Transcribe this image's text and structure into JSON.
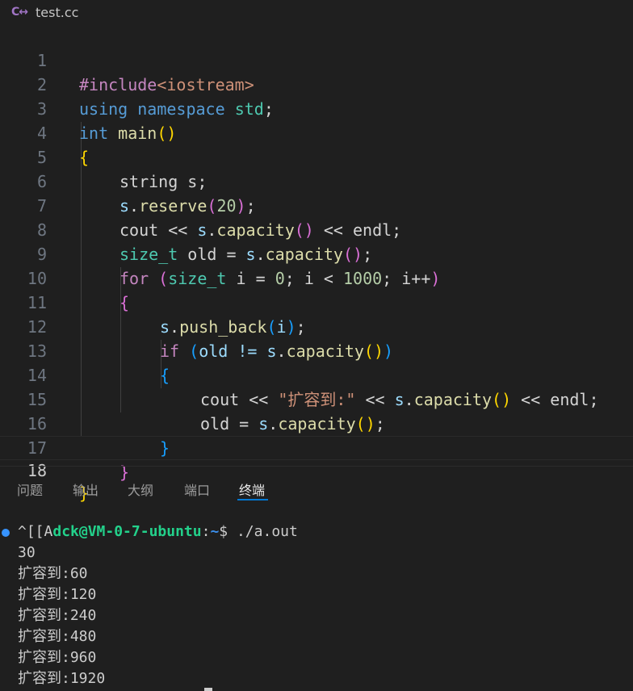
{
  "tab": {
    "icon": "cpp-icon",
    "filename": "test.cc"
  },
  "code_lines": [
    {
      "n": "1"
    },
    {
      "n": "2"
    },
    {
      "n": "3"
    },
    {
      "n": "4"
    },
    {
      "n": "5"
    },
    {
      "n": "6"
    },
    {
      "n": "7"
    },
    {
      "n": "8"
    },
    {
      "n": "9"
    },
    {
      "n": "10"
    },
    {
      "n": "11"
    },
    {
      "n": "12"
    },
    {
      "n": "13"
    },
    {
      "n": "14"
    },
    {
      "n": "15"
    },
    {
      "n": "16"
    },
    {
      "n": "17"
    },
    {
      "n": "18"
    }
  ],
  "code": {
    "l1": {
      "a": "#include",
      "b": "<iostream>"
    },
    "l2": {
      "a": "using",
      "b": "namespace",
      "c": "std",
      "d": ";"
    },
    "l3": {
      "a": "int",
      "b": "main",
      "c": "(",
      "d": ")"
    },
    "l4": {
      "a": "{"
    },
    "l5": {
      "a": "string s;"
    },
    "l6": {
      "a": "s",
      "b": ".",
      "c": "reserve",
      "d": "(",
      "e": "20",
      "f": ");"
    },
    "l7": {
      "a": "cout << ",
      "b": "s",
      "c": ".",
      "d": "capacity",
      "e": "()",
      "f": " << endl;"
    },
    "l8": {
      "a": "size_t",
      "b": " old = ",
      "c": "s",
      "d": ".",
      "e": "capacity",
      "f": "()",
      "g": ";"
    },
    "l9": {
      "a": "for",
      "b": " (",
      "c": "size_t",
      "d": " i = ",
      "e": "0",
      "f": "; i < ",
      "g": "1000",
      "h": "; i++",
      "i": ")"
    },
    "l10": {
      "a": "{"
    },
    "l11": {
      "a": "s",
      "b": ".",
      "c": "push_back",
      "d": "(",
      "e": "i",
      "f": ");"
    },
    "l12": {
      "a": "if",
      "b": " (",
      "c": "old != ",
      "d": "s",
      "e": ".",
      "f": "capacity",
      "g": "()",
      "h": ")"
    },
    "l13": {
      "a": "{"
    },
    "l14": {
      "a": "cout << ",
      "b": "\"扩容到:\"",
      "c": " << ",
      "d": "s",
      "e": ".",
      "f": "capacity",
      "g": "()",
      "h": " << endl;"
    },
    "l15": {
      "a": "old = ",
      "b": "s",
      "c": ".",
      "d": "capacity",
      "e": "()",
      "f": ";"
    },
    "l16": {
      "a": "}"
    },
    "l17": {
      "a": "}"
    },
    "l18": {
      "a": "}"
    }
  },
  "panel": {
    "tabs": [
      "问题",
      "输出",
      "大纲",
      "端口",
      "终端"
    ],
    "active_tab": "终端"
  },
  "terminal": {
    "prompt_prefix": "^[[A",
    "user_host": "dck@VM-0-7-ubuntu",
    "colon": ":",
    "path": "~",
    "dollar": "$ ",
    "command": "./a.out",
    "output": [
      "30",
      "扩容到:60",
      "扩容到:120",
      "扩容到:240",
      "扩容到:480",
      "扩容到:960",
      "扩容到:1920"
    ]
  },
  "colors": {
    "accent": "#0078d4",
    "keyword": "#569cd6",
    "control": "#c586c0",
    "function": "#dcdcaa",
    "type": "#4ec9b0",
    "string": "#ce9178",
    "number": "#b5cea8"
  }
}
